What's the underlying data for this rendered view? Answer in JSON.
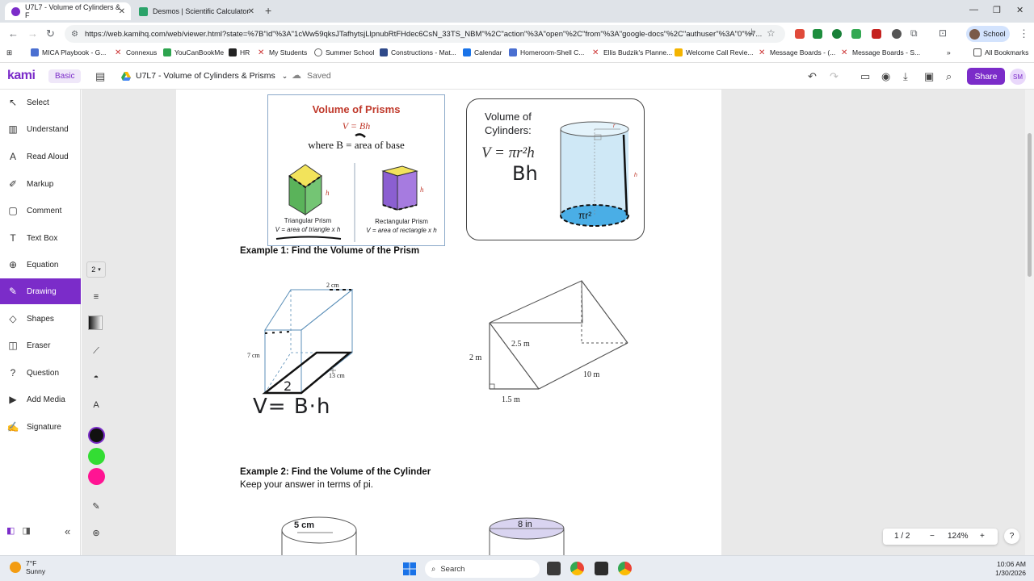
{
  "browser": {
    "tabs": [
      {
        "title": "U7L7 - Volume of Cylinders & F",
        "active": true
      },
      {
        "title": "Desmos | Scientific Calculator",
        "active": false
      }
    ],
    "url": "https://web.kamihq.com/web/viewer.html?state=%7B\"id\"%3A\"1cWw59qksJTafhytsjLlpnubRtFHdec6CsN_33TS_NBM\"%2C\"action\"%3A\"open\"%2C\"from\"%3A\"google-docs\"%2C\"authuser\"%3A\"0\"%7...",
    "profile_label": "School",
    "bookmarks": [
      "MICA Playbook - G...",
      "Connexus",
      "YouCanBookMe",
      "HR",
      "My Students",
      "Summer School",
      "Constructions - Mat...",
      "Calendar",
      "Homeroom-Shell C...",
      "Ellis Budzik's Planne...",
      "Welcome Call Revie...",
      "Message Boards - (...",
      "Message Boards - S..."
    ],
    "all_bookmarks": "All Bookmarks"
  },
  "kami": {
    "logo": "kami",
    "plan": "Basic",
    "doc_title": "U7L7 - Volume of Cylinders & Prisms",
    "save_status": "Saved",
    "share_label": "Share",
    "user_initials": "SM"
  },
  "sidebar": {
    "items": [
      {
        "label": "Select",
        "icon": "cursor-icon"
      },
      {
        "label": "Understand",
        "icon": "dictionary-icon"
      },
      {
        "label": "Read Aloud",
        "icon": "speaker-icon"
      },
      {
        "label": "Markup",
        "icon": "highlighter-icon"
      },
      {
        "label": "Comment",
        "icon": "comment-icon"
      },
      {
        "label": "Text Box",
        "icon": "text-icon"
      },
      {
        "label": "Equation",
        "icon": "equation-icon"
      },
      {
        "label": "Drawing",
        "icon": "pen-icon",
        "active": true
      },
      {
        "label": "Shapes",
        "icon": "shapes-icon"
      },
      {
        "label": "Eraser",
        "icon": "eraser-icon"
      },
      {
        "label": "Question",
        "icon": "question-icon"
      },
      {
        "label": "Add Media",
        "icon": "media-icon"
      },
      {
        "label": "Signature",
        "icon": "signature-icon"
      }
    ]
  },
  "drawing_tools": {
    "size": "2",
    "colors": [
      "#111111",
      "#33dd33",
      "#ff1493"
    ]
  },
  "document": {
    "prisms_box": {
      "title": "Volume of Prisms",
      "formula": "V = Bh",
      "where": "where B = area of base",
      "tri_label": "Triangular Prism",
      "tri_formula": "V = area of triangle x h",
      "rect_label": "Rectangular Prism",
      "rect_formula": "V = area of rectangle x h"
    },
    "cylinders_box": {
      "title_line1": "Volume of",
      "title_line2": "Cylinders:",
      "formula": "V = πr²h",
      "handwritten": "Bh",
      "base_handwritten": "πr²"
    },
    "example1": {
      "title": "Example 1: Find the Volume of the Prism",
      "box_top": "2 cm",
      "box_side": "7 cm",
      "box_depth": "13 cm",
      "handwritten_base": "2",
      "handwritten_formula": "V= B·h",
      "tri_slant": "2.5 m",
      "tri_height": "2 m",
      "tri_base": "1.5 m",
      "tri_length": "10 m"
    },
    "example2": {
      "title": "Example 2: Find the Volume of the Cylinder",
      "subtitle": "Keep your answer in terms of pi.",
      "cyl1_label": "5 cm",
      "cyl2_label": "8 in"
    }
  },
  "pager": {
    "page": "1 / 2",
    "zoom": "124%"
  },
  "taskbar": {
    "temp": "7°F",
    "condition": "Sunny",
    "search_placeholder": "Search",
    "time": "10:06 AM",
    "date": "1/30/2026"
  }
}
